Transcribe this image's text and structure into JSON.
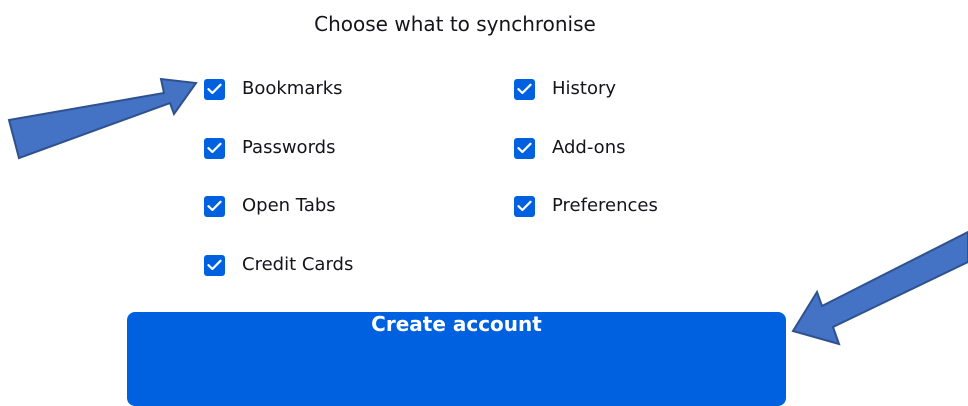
{
  "heading": "Choose what to synchronise",
  "sync_options": [
    {
      "label": "Bookmarks",
      "checked": true
    },
    {
      "label": "History",
      "checked": true
    },
    {
      "label": "Passwords",
      "checked": true
    },
    {
      "label": "Add-ons",
      "checked": true
    },
    {
      "label": "Open Tabs",
      "checked": true
    },
    {
      "label": "Preferences",
      "checked": true
    },
    {
      "label": "Credit Cards",
      "checked": true
    }
  ],
  "create_button_label": "Create account",
  "colors": {
    "accent": "#0061e0",
    "text": "#15141a",
    "annotation_arrow_fill": "#4472c4",
    "annotation_arrow_stroke": "#2f528f"
  },
  "annotations": [
    {
      "type": "arrow",
      "points_to": "Bookmarks"
    },
    {
      "type": "arrow",
      "points_to": "Create account"
    }
  ]
}
